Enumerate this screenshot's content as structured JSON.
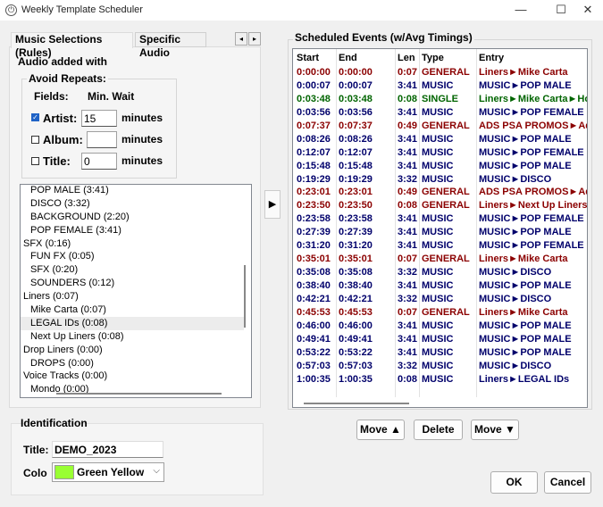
{
  "window": {
    "title": "Weekly Template Scheduler"
  },
  "tabs": [
    "Music Selections (Rules)",
    "Specific Audio"
  ],
  "tab_nav": {
    "prev": "◂",
    "next": "▸"
  },
  "rules": {
    "audio_added_with": "Audio added with",
    "avoid_repeats": "Avoid Repeats:",
    "fields_label": "Fields:",
    "min_wait_label": "Min. Wait",
    "minutes": "minutes",
    "artist": {
      "label": "Artist:",
      "checked": true,
      "value": "15"
    },
    "album": {
      "label": "Album:",
      "checked": false,
      "value": ""
    },
    "title": {
      "label": "Title:",
      "checked": false,
      "value": "0"
    }
  },
  "tree": [
    {
      "text": "POP MALE (3:41)",
      "level": "child"
    },
    {
      "text": "DISCO (3:32)",
      "level": "child"
    },
    {
      "text": "BACKGROUND (2:20)",
      "level": "child"
    },
    {
      "text": "POP FEMALE (3:41)",
      "level": "child"
    },
    {
      "text": "SFX (0:16)",
      "level": "parent"
    },
    {
      "text": "FUN FX (0:05)",
      "level": "child"
    },
    {
      "text": "SFX (0:20)",
      "level": "child"
    },
    {
      "text": "SOUNDERS (0:12)",
      "level": "child"
    },
    {
      "text": "Liners (0:07)",
      "level": "parent"
    },
    {
      "text": "Mike Carta (0:07)",
      "level": "child"
    },
    {
      "text": "LEGAL IDs (0:08)",
      "level": "child",
      "selected": true
    },
    {
      "text": "Next Up Liners (0:08)",
      "level": "child"
    },
    {
      "text": "Drop Liners (0:00)",
      "level": "parent"
    },
    {
      "text": "DROPS (0:00)",
      "level": "child"
    },
    {
      "text": "Voice Tracks (0:00)",
      "level": "parent"
    },
    {
      "text": "Mondo (0:00)",
      "level": "child"
    }
  ],
  "move_right_glyph": "▶",
  "identification": {
    "heading": "Identification",
    "title_label": "Title:",
    "title_value": "DEMO_2023",
    "color_label": "Colo",
    "color_value": "Green Yellow",
    "color_hex": "#99ff33"
  },
  "schedule": {
    "heading": "Scheduled Events (w/Avg Timings)",
    "columns": [
      "Start",
      "End",
      "Len",
      "Type",
      "Entry"
    ],
    "type_colors": {
      "GENERAL": "#8b0000",
      "MUSIC": "#00006b",
      "SINGLE": "#006400"
    },
    "rows": [
      [
        "0:00:00",
        "0:00:00",
        "0:07",
        "GENERAL",
        "Liners►Mike Carta"
      ],
      [
        "0:00:07",
        "0:00:07",
        "3:41",
        "MUSIC",
        "MUSIC►POP MALE"
      ],
      [
        "0:03:48",
        "0:03:48",
        "0:08",
        "SINGLE",
        "Liners►Mike Carta►Hott"
      ],
      [
        "0:03:56",
        "0:03:56",
        "3:41",
        "MUSIC",
        "MUSIC►POP FEMALE"
      ],
      [
        "0:07:37",
        "0:07:37",
        "0:49",
        "GENERAL",
        "ADS PSA PROMOS►Ads"
      ],
      [
        "0:08:26",
        "0:08:26",
        "3:41",
        "MUSIC",
        "MUSIC►POP MALE"
      ],
      [
        "0:12:07",
        "0:12:07",
        "3:41",
        "MUSIC",
        "MUSIC►POP FEMALE"
      ],
      [
        "0:15:48",
        "0:15:48",
        "3:41",
        "MUSIC",
        "MUSIC►POP MALE"
      ],
      [
        "0:19:29",
        "0:19:29",
        "3:32",
        "MUSIC",
        "MUSIC►DISCO"
      ],
      [
        "0:23:01",
        "0:23:01",
        "0:49",
        "GENERAL",
        "ADS PSA PROMOS►Ads"
      ],
      [
        "0:23:50",
        "0:23:50",
        "0:08",
        "GENERAL",
        "Liners►Next Up Liners"
      ],
      [
        "0:23:58",
        "0:23:58",
        "3:41",
        "MUSIC",
        "MUSIC►POP FEMALE"
      ],
      [
        "0:27:39",
        "0:27:39",
        "3:41",
        "MUSIC",
        "MUSIC►POP MALE"
      ],
      [
        "0:31:20",
        "0:31:20",
        "3:41",
        "MUSIC",
        "MUSIC►POP FEMALE"
      ],
      [
        "0:35:01",
        "0:35:01",
        "0:07",
        "GENERAL",
        "Liners►Mike Carta"
      ],
      [
        "0:35:08",
        "0:35:08",
        "3:32",
        "MUSIC",
        "MUSIC►DISCO"
      ],
      [
        "0:38:40",
        "0:38:40",
        "3:41",
        "MUSIC",
        "MUSIC►POP MALE"
      ],
      [
        "0:42:21",
        "0:42:21",
        "3:32",
        "MUSIC",
        "MUSIC►DISCO"
      ],
      [
        "0:45:53",
        "0:45:53",
        "0:07",
        "GENERAL",
        "Liners►Mike Carta"
      ],
      [
        "0:46:00",
        "0:46:00",
        "3:41",
        "MUSIC",
        "MUSIC►POP MALE"
      ],
      [
        "0:49:41",
        "0:49:41",
        "3:41",
        "MUSIC",
        "MUSIC►POP MALE"
      ],
      [
        "0:53:22",
        "0:53:22",
        "3:41",
        "MUSIC",
        "MUSIC►POP MALE"
      ],
      [
        "0:57:03",
        "0:57:03",
        "3:32",
        "MUSIC",
        "MUSIC►DISCO"
      ],
      [
        "1:00:35",
        "1:00:35",
        "0:08",
        "MUSIC",
        "Liners►LEGAL IDs"
      ]
    ]
  },
  "buttons": {
    "move_up": "Move ▲",
    "delete": "Delete",
    "move_down": "Move ▼",
    "ok": "OK",
    "cancel": "Cancel"
  },
  "window_controls": {
    "minimize": "—",
    "maximize": "☐",
    "close": "✕"
  }
}
